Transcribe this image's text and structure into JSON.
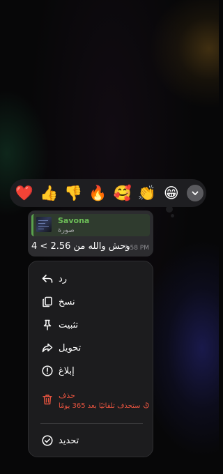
{
  "reactions": {
    "items": [
      {
        "name": "heart",
        "glyph": "❤️"
      },
      {
        "name": "thumbs-up",
        "glyph": "👍"
      },
      {
        "name": "thumbs-down",
        "glyph": "👎"
      },
      {
        "name": "fire",
        "glyph": "🔥"
      },
      {
        "name": "smiling-face-with-hearts",
        "glyph": "🥰"
      },
      {
        "name": "clapping-hands",
        "glyph": "👏"
      },
      {
        "name": "beaming-face",
        "glyph": "😁"
      }
    ],
    "expand_icon": "chevron-down-icon"
  },
  "message": {
    "reply_name": "Savona",
    "reply_subtitle": "صورة",
    "text": "وحش والله من 2.56 > 4",
    "time": "7:58 PM"
  },
  "menu": {
    "reply": "رد",
    "copy": "نسخ",
    "pin": "تثبيت",
    "forward": "تحويل",
    "report": "إبلاغ",
    "delete_title": "حذف",
    "delete_note": "ستحذف تلقائيًا بعد 365 يومًا",
    "select": "تحديد"
  },
  "colors": {
    "accent_green": "#6cbd57",
    "danger": "#e5533f",
    "menu_bg": "#1c1c1e",
    "bubble_bg": "#2c2c2f"
  }
}
